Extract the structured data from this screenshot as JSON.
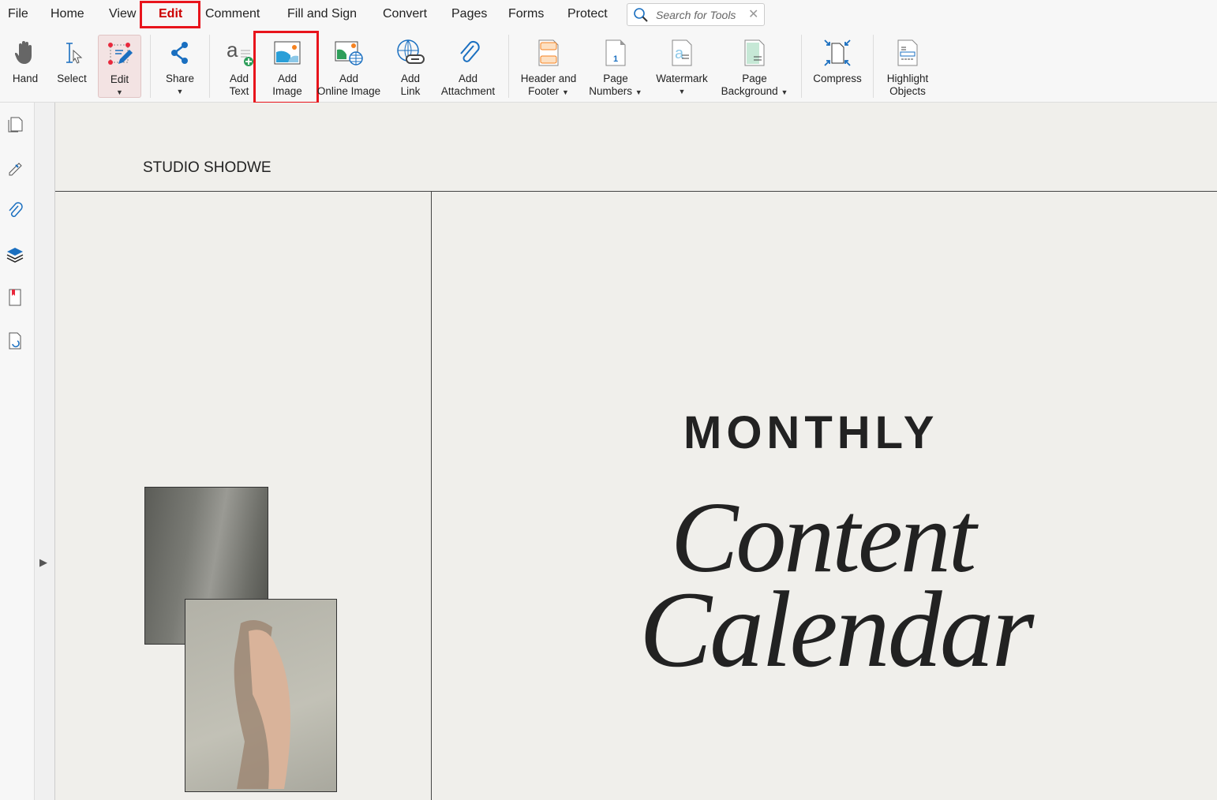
{
  "menu": {
    "items": [
      "File",
      "Home",
      "View",
      "Edit",
      "Comment",
      "Fill and Sign",
      "Convert",
      "Pages",
      "Forms",
      "Protect"
    ],
    "active": "Edit"
  },
  "search": {
    "placeholder": "Search for Tools"
  },
  "toolbar": {
    "hand": "Hand",
    "select": "Select",
    "edit": "Edit",
    "share": "Share",
    "add_text": [
      "Add",
      "Text"
    ],
    "add_image": [
      "Add",
      "Image"
    ],
    "add_online_image": [
      "Add",
      "Online Image"
    ],
    "add_link": [
      "Add",
      "Link"
    ],
    "add_attachment": [
      "Add",
      "Attachment"
    ],
    "header_footer": [
      "Header and",
      "Footer"
    ],
    "page_numbers": [
      "Page",
      "Numbers"
    ],
    "watermark": "Watermark",
    "page_background": [
      "Page",
      "Background"
    ],
    "compress": "Compress",
    "highlight_objects": [
      "Highlight",
      "Objects"
    ]
  },
  "document": {
    "studio": "STUDIO SHODWE",
    "monthly": "MONTHLY",
    "title_line1": "Content",
    "title_line2": "Calendar"
  },
  "colors": {
    "accent": "#e8141c",
    "blue": "#1a6fc0"
  }
}
